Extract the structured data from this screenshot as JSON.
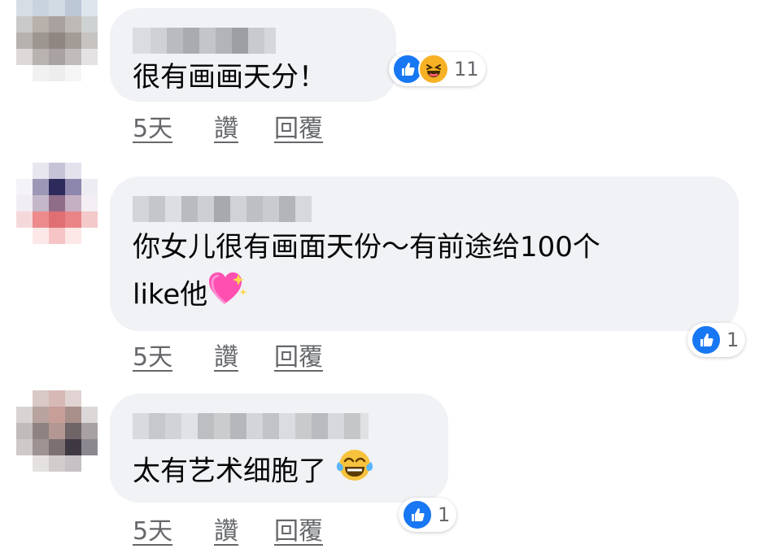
{
  "comments": [
    {
      "text": "很有画画天分！",
      "reaction_count": "11",
      "reactions": [
        "like-icon",
        "haha-icon"
      ],
      "time": "5天",
      "like_label": "讚",
      "reply_label": "回覆"
    },
    {
      "text": "你女儿很有画面天份～有前途给100个\nlike他",
      "emoji": "sparkling-heart-icon",
      "reaction_count": "1",
      "reactions": [
        "like-icon"
      ],
      "time": "5天",
      "like_label": "讚",
      "reply_label": "回覆"
    },
    {
      "text": "太有艺术细胞了",
      "emoji": "tears-of-joy-icon",
      "reaction_count": "1",
      "reactions": [
        "like-icon"
      ],
      "time": "5天",
      "like_label": "讚",
      "reply_label": "回覆"
    }
  ],
  "colors": {
    "bubble": "#f0f2f5",
    "action_text": "#65676b",
    "like_blue": "#1877f2",
    "haha_yellow": "#f7b125"
  }
}
